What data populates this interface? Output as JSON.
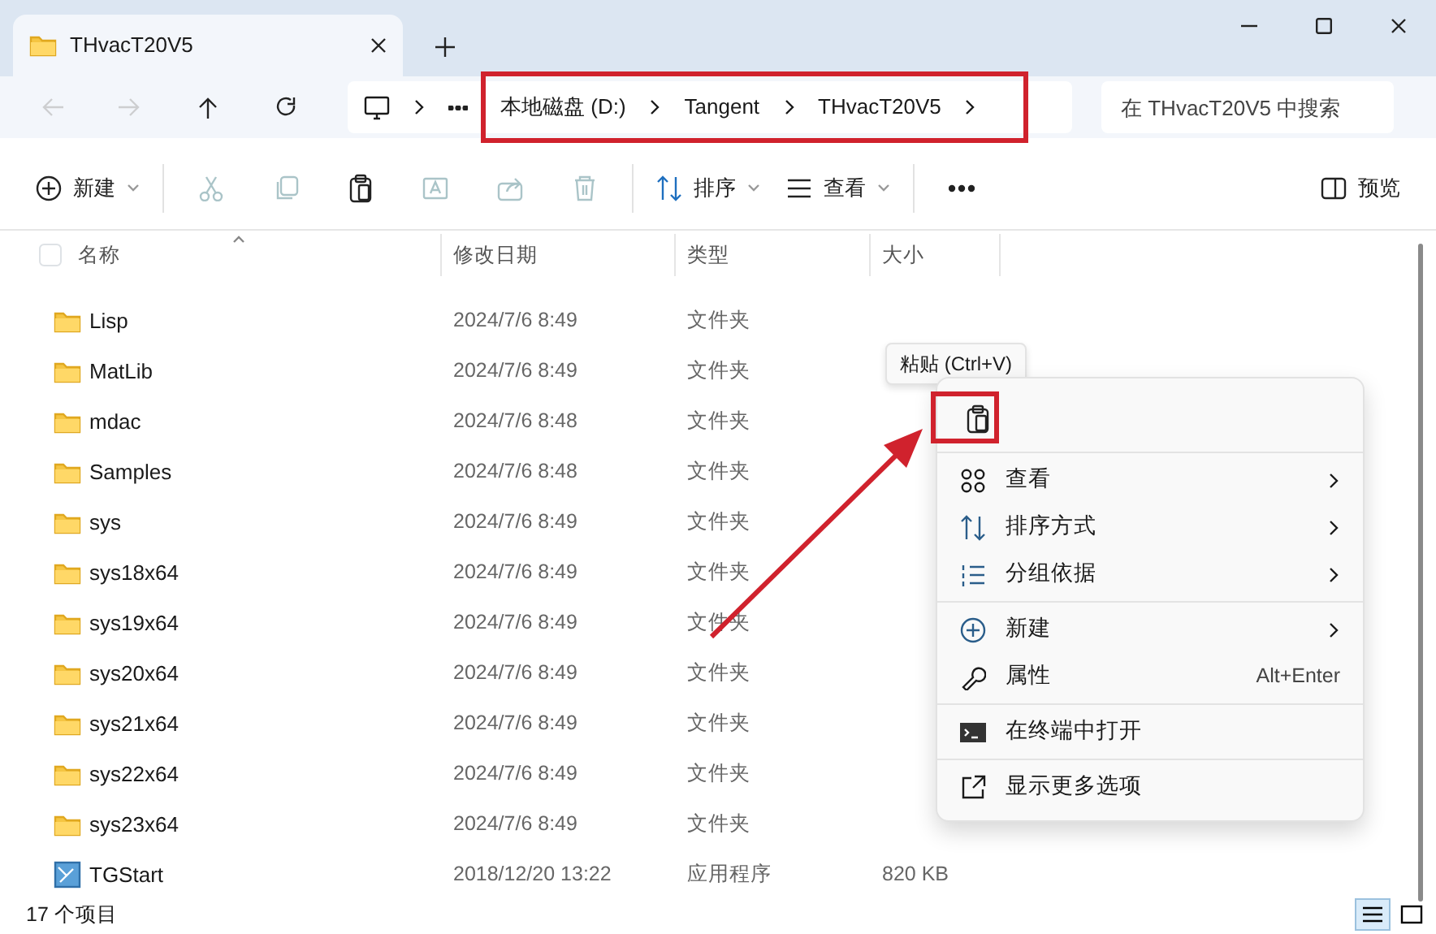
{
  "window": {
    "tab_title": "THvacT20V5"
  },
  "address_bar": {
    "segments": [
      "本地磁盘 (D:)",
      "Tangent",
      "THvacT20V5"
    ],
    "search_placeholder": "在 THvacT20V5 中搜索"
  },
  "nav": [
    {
      "disabled": true
    },
    {
      "disabled": true
    },
    {
      "disabled": false
    },
    {
      "disabled": false
    }
  ],
  "toolbar": [
    {
      "label": "新建",
      "disabled": false,
      "dropdown": true
    },
    {
      "disabled": true
    },
    {
      "disabled": true
    },
    {
      "disabled": false
    },
    {
      "disabled": true
    },
    {
      "disabled": true
    },
    {
      "disabled": true
    },
    {
      "label": "排序",
      "disabled": false,
      "dropdown": true
    },
    {
      "label": "查看",
      "disabled": false,
      "dropdown": true
    },
    {
      "disabled": false
    },
    {
      "label": "预览",
      "disabled": false
    }
  ],
  "table": {
    "select_all_checked": false,
    "columns": [
      "名称",
      "修改日期",
      "类型",
      "大小"
    ],
    "rows": [
      {
        "kind": "folder",
        "name": "Lisp",
        "date": "2024/7/6 8:49",
        "type": "文件夹"
      },
      {
        "kind": "folder",
        "name": "MatLib",
        "date": "2024/7/6 8:49",
        "type": "文件夹"
      },
      {
        "kind": "folder",
        "name": "mdac",
        "date": "2024/7/6 8:48",
        "type": "文件夹"
      },
      {
        "kind": "folder",
        "name": "Samples",
        "date": "2024/7/6 8:48",
        "type": "文件夹"
      },
      {
        "kind": "folder",
        "name": "sys",
        "date": "2024/7/6 8:49",
        "type": "文件夹"
      },
      {
        "kind": "folder",
        "name": "sys18x64",
        "date": "2024/7/6 8:49",
        "type": "文件夹"
      },
      {
        "kind": "folder",
        "name": "sys19x64",
        "date": "2024/7/6 8:49",
        "type": "文件夹"
      },
      {
        "kind": "folder",
        "name": "sys20x64",
        "date": "2024/7/6 8:49",
        "type": "文件夹"
      },
      {
        "kind": "folder",
        "name": "sys21x64",
        "date": "2024/7/6 8:49",
        "type": "文件夹"
      },
      {
        "kind": "folder",
        "name": "sys22x64",
        "date": "2024/7/6 8:49",
        "type": "文件夹"
      },
      {
        "kind": "folder",
        "name": "sys23x64",
        "date": "2024/7/6 8:49",
        "type": "文件夹"
      },
      {
        "kind": "app",
        "name": "TGStart",
        "date": "2018/12/20 13:22",
        "type": "应用程序",
        "size": "820 KB"
      }
    ]
  },
  "tooltip": "粘贴 (Ctrl+V)",
  "context_menu": {
    "groups": [
      [
        {
          "label": "查看",
          "submenu": true
        },
        {
          "label": "排序方式",
          "submenu": true
        },
        {
          "label": "分组依据",
          "submenu": true
        }
      ],
      [
        {
          "label": "新建",
          "submenu": true
        },
        {
          "label": "属性",
          "shortcut": "Alt+Enter",
          "submenu": false
        }
      ],
      [
        {
          "label": "在终端中打开",
          "submenu": false
        }
      ],
      [
        {
          "label": "显示更多选项",
          "submenu": false
        }
      ]
    ]
  },
  "status_bar": {
    "count": "17 个项目",
    "views": [
      {
        "selected": true
      },
      {
        "selected": false
      }
    ]
  }
}
